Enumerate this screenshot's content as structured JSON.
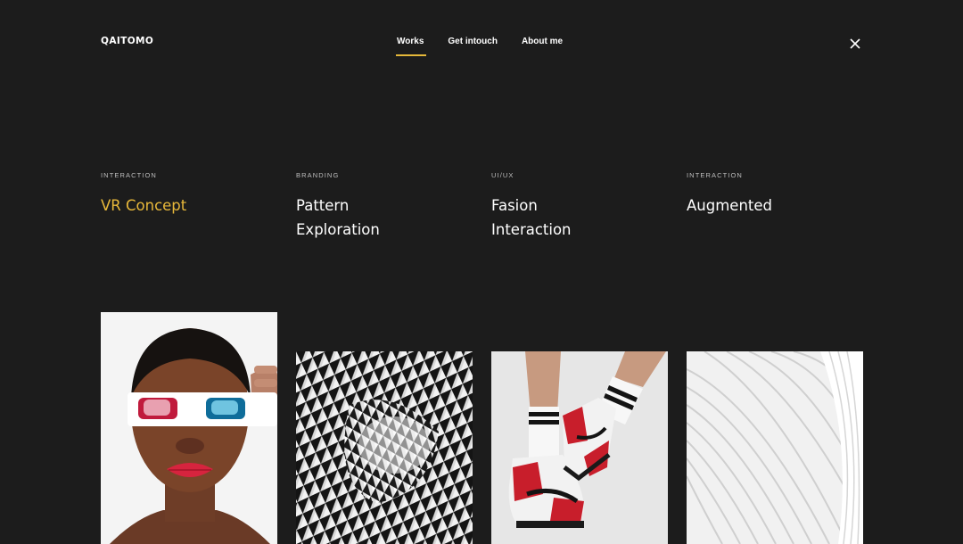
{
  "brand": {
    "logo": "QAITOMO"
  },
  "nav": {
    "items": [
      {
        "label": "Works",
        "active": true
      },
      {
        "label": "Get intouch",
        "active": false
      },
      {
        "label": "About me",
        "active": false
      }
    ],
    "close_icon": "close-icon"
  },
  "colors": {
    "background": "#1c1c1c",
    "accent": "#e5b83a",
    "text": "#ffffff",
    "muted": "#bdbdbd"
  },
  "projects": [
    {
      "category": "INTERACTION",
      "title": "VR Concept",
      "highlighted": true
    },
    {
      "category": "BRANDING",
      "title_line1": "Pattern",
      "title_line2": "Exploration",
      "highlighted": false
    },
    {
      "category": "UI/UX",
      "title_line1": "Fasion",
      "title_line2": "Interaction",
      "highlighted": false
    },
    {
      "category": "INTERACTION",
      "title": "Augmented",
      "highlighted": false
    }
  ]
}
